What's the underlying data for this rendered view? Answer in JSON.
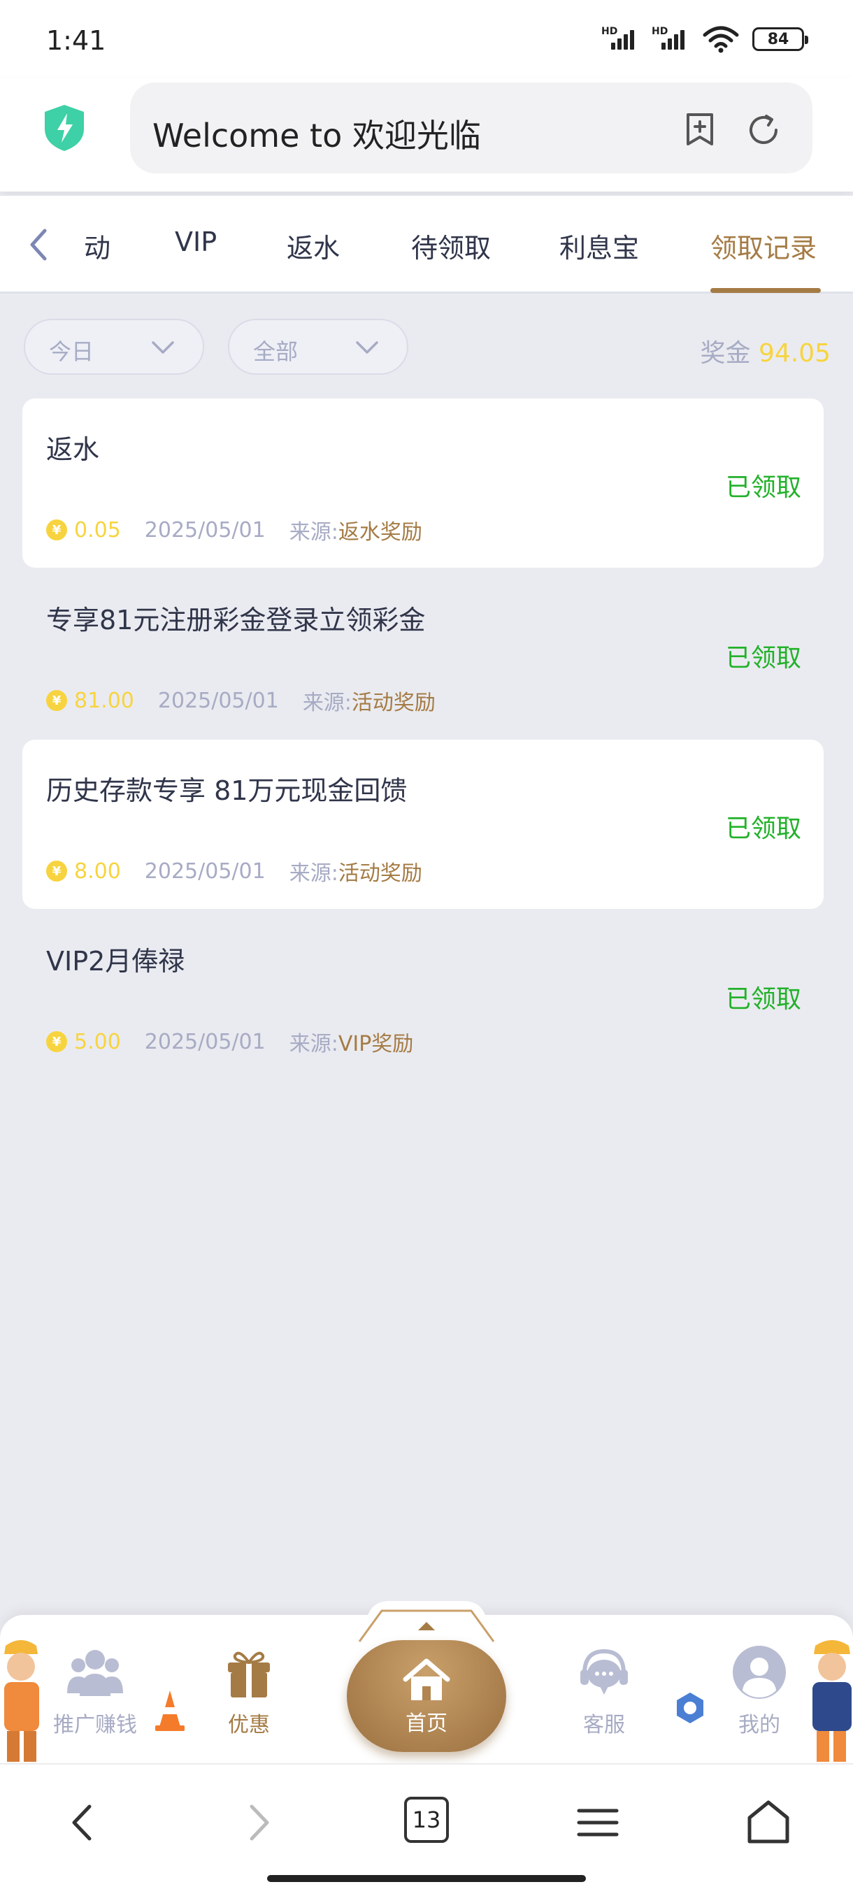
{
  "status_bar": {
    "time": "1:41",
    "signal_tag": "HD",
    "battery": "84"
  },
  "browser": {
    "title": "Welcome to 欢迎光临"
  },
  "tabs": [
    {
      "label": "动"
    },
    {
      "label": "VIP"
    },
    {
      "label": "返水"
    },
    {
      "label": "待领取"
    },
    {
      "label": "利息宝"
    },
    {
      "label": "领取记录",
      "active": true
    }
  ],
  "filters": {
    "date": "今日",
    "type": "全部"
  },
  "bonus": {
    "label": "奖金",
    "value": "94.05"
  },
  "records": [
    {
      "title": "返水",
      "status": "已领取",
      "coin": "¥",
      "amount": "0.05",
      "date": "2025/05/01",
      "source_label": "来源:",
      "source_value": "返水奖励"
    },
    {
      "title": "专享81元注册彩金登录立领彩金",
      "status": "已领取",
      "coin": "¥",
      "amount": "81.00",
      "date": "2025/05/01",
      "source_label": "来源:",
      "source_value": "活动奖励"
    },
    {
      "title": "历史存款专享 81万元现金回馈",
      "status": "已领取",
      "coin": "¥",
      "amount": "8.00",
      "date": "2025/05/01",
      "source_label": "来源:",
      "source_value": "活动奖励"
    },
    {
      "title": "VIP2月俸禄",
      "status": "已领取",
      "coin": "¥",
      "amount": "5.00",
      "date": "2025/05/01",
      "source_label": "来源:",
      "source_value": "VIP奖励"
    }
  ],
  "bottom_nav": {
    "promote": "推广赚钱",
    "offers": "优惠",
    "home": "首页",
    "service": "客服",
    "mine": "我的"
  },
  "browser_toolbar": {
    "tab_count": "13"
  },
  "colors": {
    "gold": "#a57b45",
    "yellow": "#f7d43f",
    "green": "#22b12a",
    "muted": "#a7abc4",
    "background": "#eaebf0"
  }
}
